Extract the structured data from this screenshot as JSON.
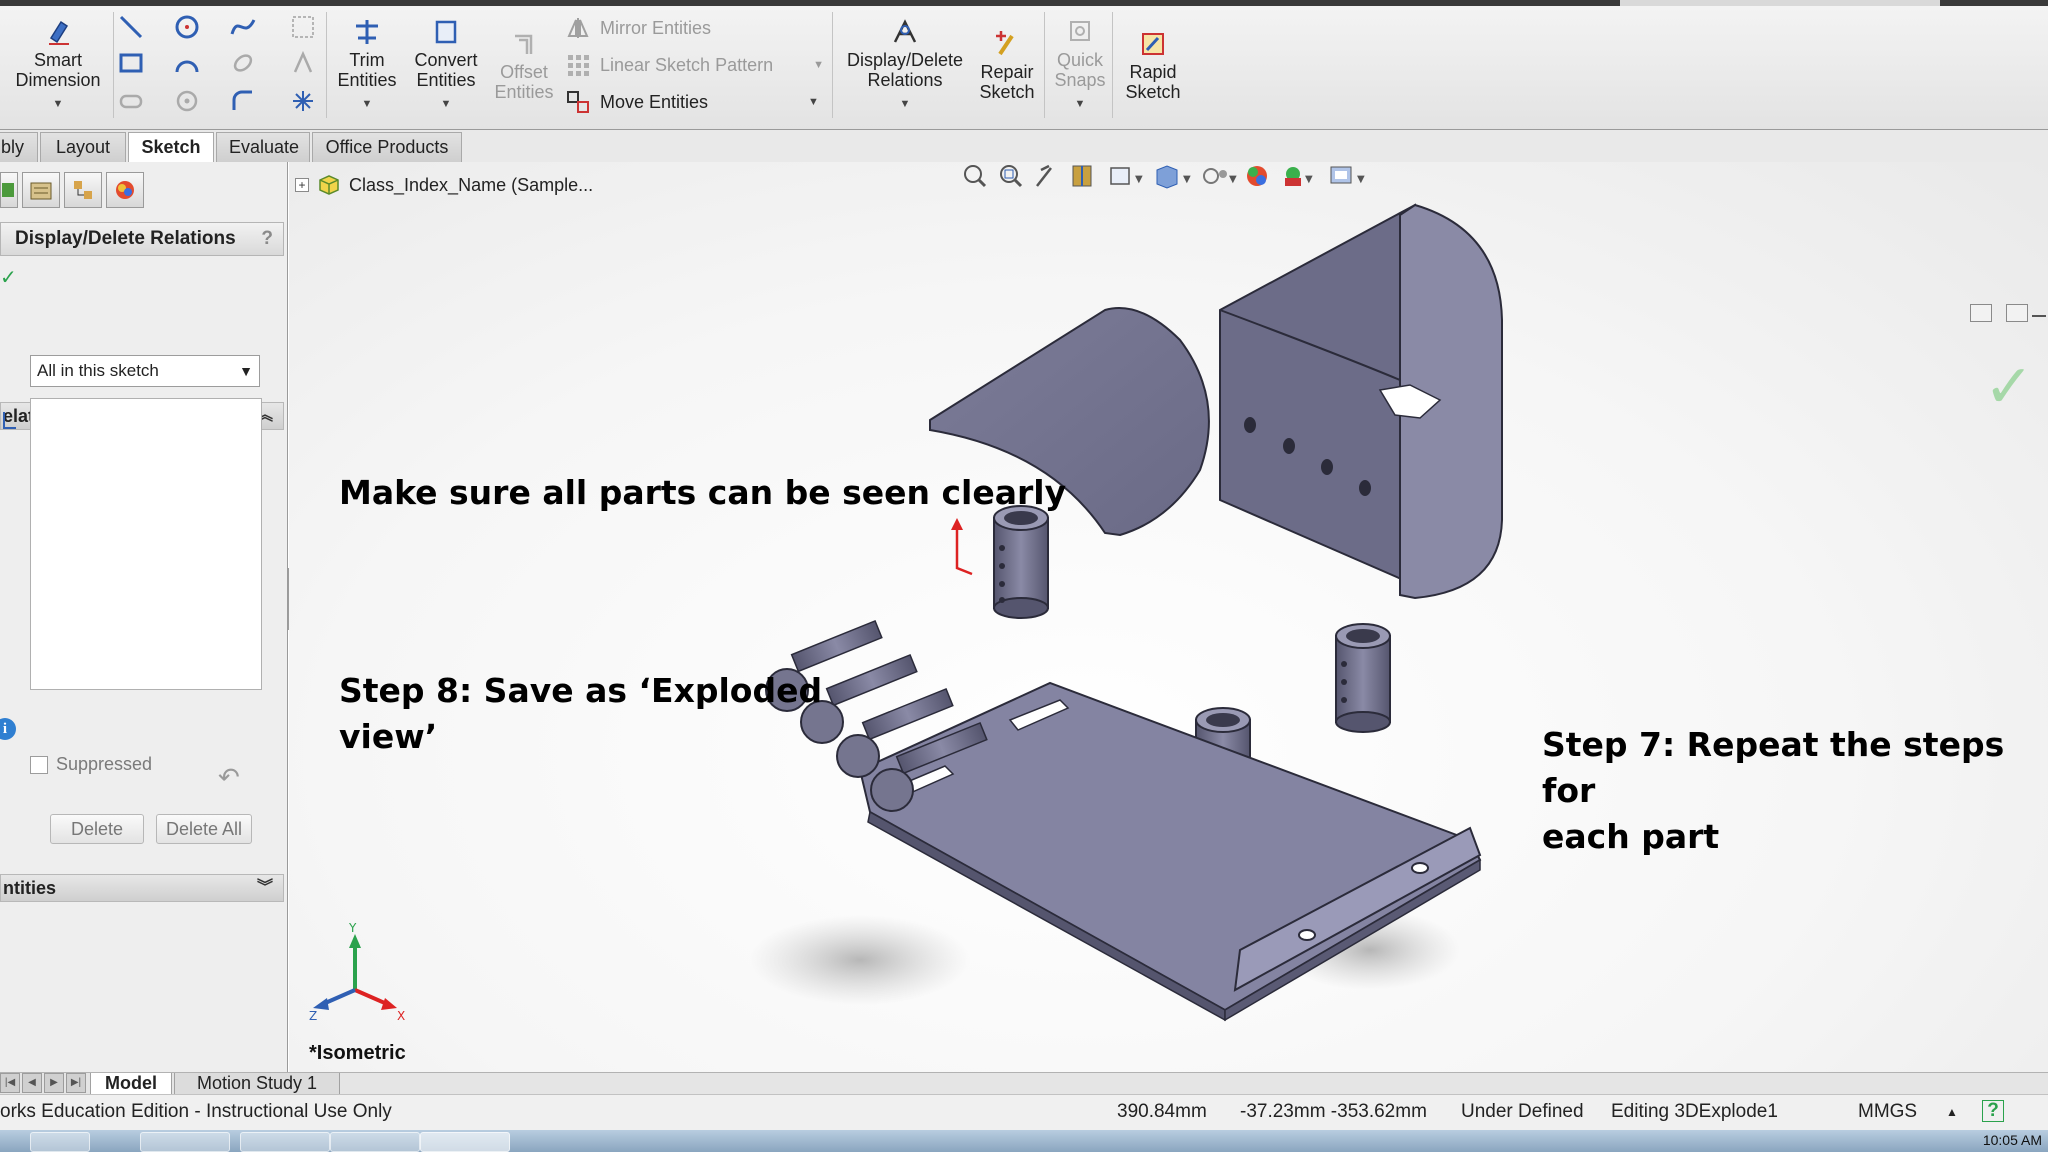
{
  "ribbon": {
    "smart_dimension": {
      "line1": "Smart",
      "line2": "Dimension"
    },
    "trim_entities": {
      "line1": "Trim",
      "line2": "Entities"
    },
    "convert_entities": {
      "line1": "Convert",
      "line2": "Entities"
    },
    "offset_entities": {
      "line1": "Offset",
      "line2": "Entities"
    },
    "mirror_entities": "Mirror Entities",
    "linear_sketch_pattern": "Linear Sketch Pattern",
    "move_entities": "Move Entities",
    "display_delete_relations": {
      "line1": "Display/Delete",
      "line2": "Relations"
    },
    "repair_sketch": {
      "line1": "Repair",
      "line2": "Sketch"
    },
    "quick_snaps": {
      "line1": "Quick",
      "line2": "Snaps"
    },
    "rapid_sketch": {
      "line1": "Rapid",
      "line2": "Sketch"
    }
  },
  "tabs": [
    "bly",
    "Layout",
    "Sketch",
    "Evaluate",
    "Office Products"
  ],
  "active_tab": "Sketch",
  "panel": {
    "title": "Display/Delete Relations",
    "help": "?",
    "relations_header": "elations",
    "filter_value": "All in this sketch",
    "suppressed_label": "Suppressed",
    "delete_button": "Delete",
    "delete_all_button": "Delete All",
    "entities_header": "ntities"
  },
  "tree": {
    "root": "Class_Index_Name (Sample..."
  },
  "captions": {
    "c1": "Make sure all parts can be seen clearly",
    "c2_line1": "Step 8: Save as ‘Exploded",
    "c2_line2": "view’",
    "c3_line1": "Step 7: Repeat the steps for",
    "c3_line2": "each part"
  },
  "view": {
    "orientation": "*Isometric",
    "triad": {
      "x": "X",
      "y": "Y",
      "z": "Z"
    }
  },
  "bottom_tabs": [
    "Model",
    "Motion Study 1"
  ],
  "status": {
    "edition": "orks Education Edition - Instructional Use Only",
    "measure": "390.84mm",
    "coords": "-37.23mm -353.62mm",
    "state": "Under Defined",
    "editing": "Editing 3DExplode1",
    "units": "MMGS",
    "help": "?"
  },
  "taskbar": {
    "clock": "10:05 AM"
  },
  "colors": {
    "part_fill": "#70708c",
    "part_edge": "#2b2b3a",
    "accent_blue": "#2f5fb3"
  }
}
